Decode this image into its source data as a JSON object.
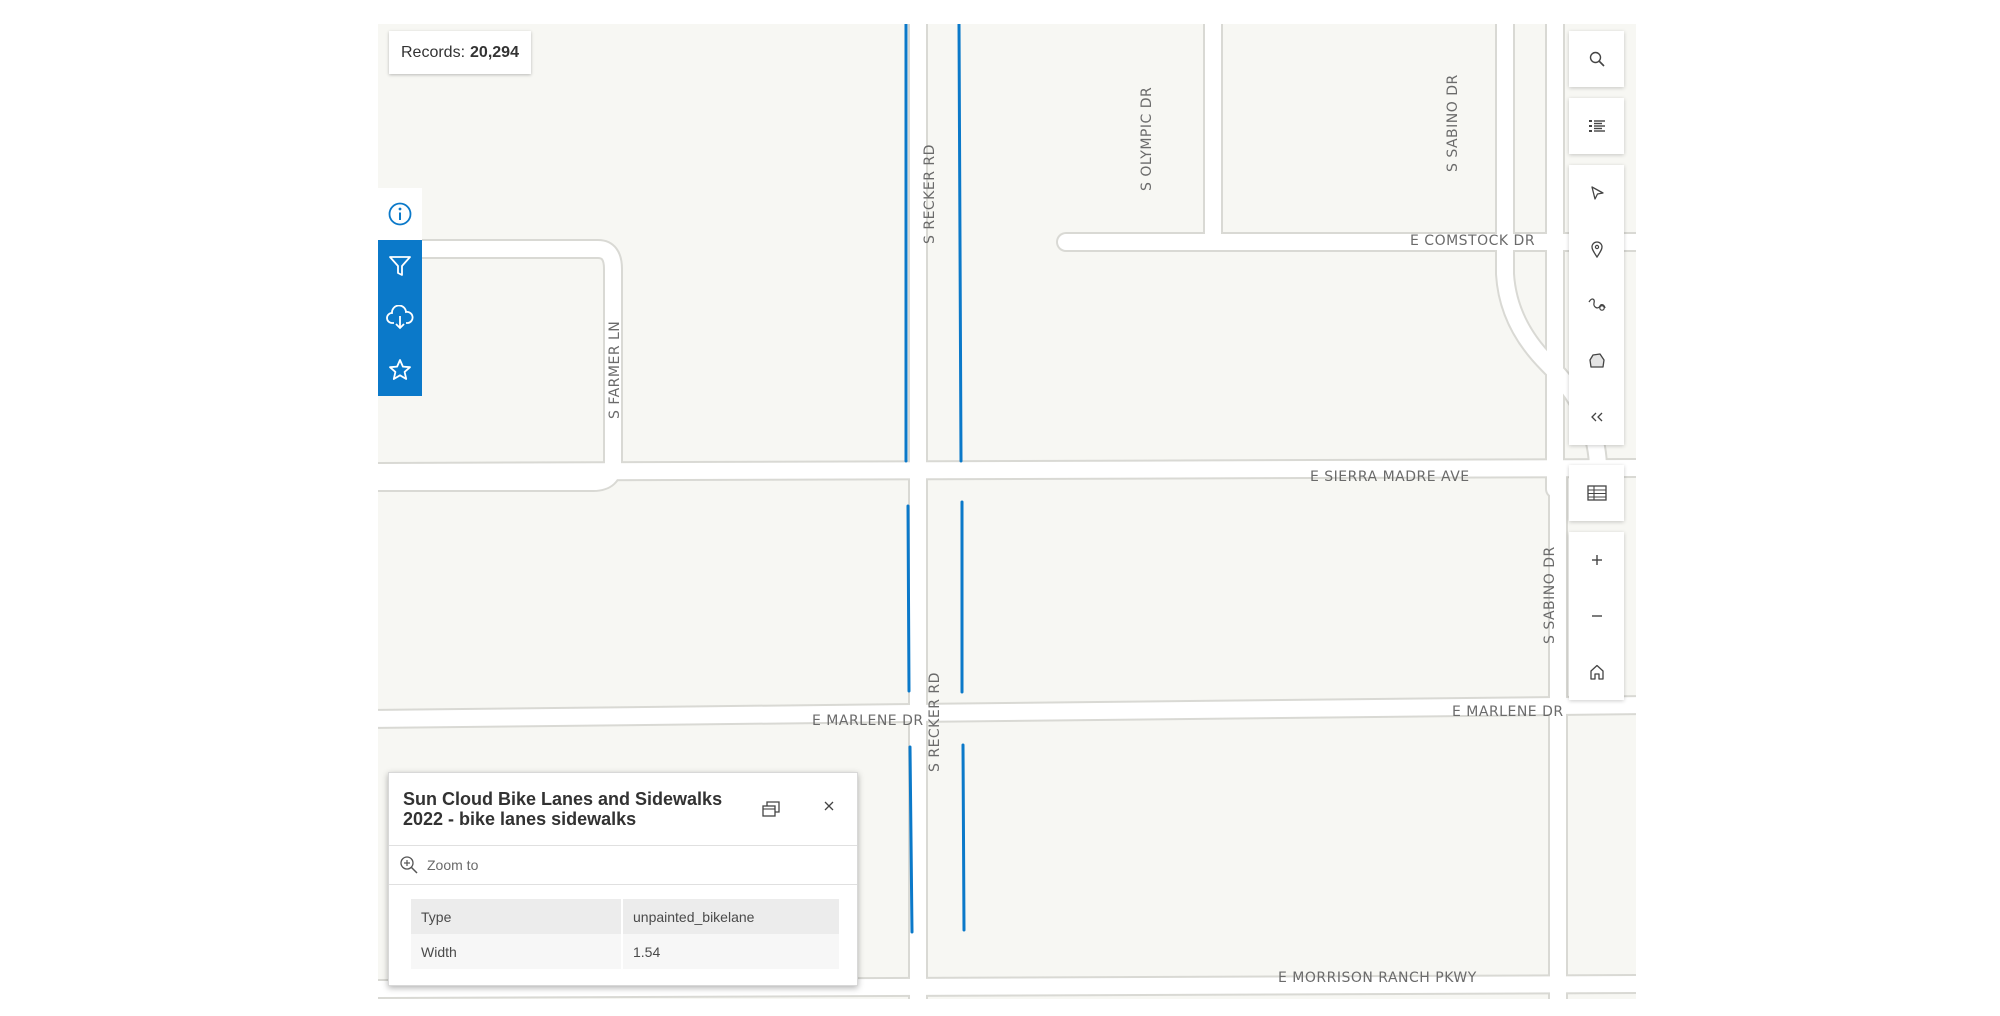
{
  "records": {
    "label": "Records:",
    "count": "20,294"
  },
  "left_rail": [
    {
      "icon": "info-icon",
      "active": true
    },
    {
      "icon": "filter-icon",
      "active": false
    },
    {
      "icon": "download-icon",
      "active": false
    },
    {
      "icon": "star-icon",
      "active": false
    }
  ],
  "tools": {
    "search": "search-icon",
    "legend": "legend-list-icon",
    "select": "cursor-icon",
    "point": "map-pin-icon",
    "line": "squiggle-line-icon",
    "polygon": "polygon-icon",
    "collapse": "collapse-double-chevron-icon",
    "table": "table-icon",
    "zoom_in": "plus-icon",
    "zoom_out": "minus-icon",
    "home": "home-icon"
  },
  "road_labels": {
    "recker_north": "S RECKER RD",
    "recker_south": "S RECKER RD",
    "olympic": "S OLYMPIC DR",
    "sabino_north": "S SABINO DR",
    "sabino_south": "S SABINO DR",
    "comstock": "E COMSTOCK DR",
    "farmer": "S FARMER LN",
    "sierra_madre": "E SIERRA MADRE AVE",
    "marlene_west": "E MARLENE DR",
    "marlene_east": "E MARLENE DR",
    "morrison": "E MORRISON RANCH PKWY"
  },
  "colors": {
    "bike_lane": "#0b79c9",
    "rail": "#0b79c9",
    "map_bg": "#f7f7f3"
  },
  "popup": {
    "title": "Sun Cloud Bike Lanes and Sidewalks 2022 - bike lanes sidewalks",
    "zoom_to": "Zoom to",
    "rows": [
      {
        "key": "Type",
        "value": "unpainted_bikelane"
      },
      {
        "key": "Width",
        "value": "1.54"
      }
    ]
  }
}
